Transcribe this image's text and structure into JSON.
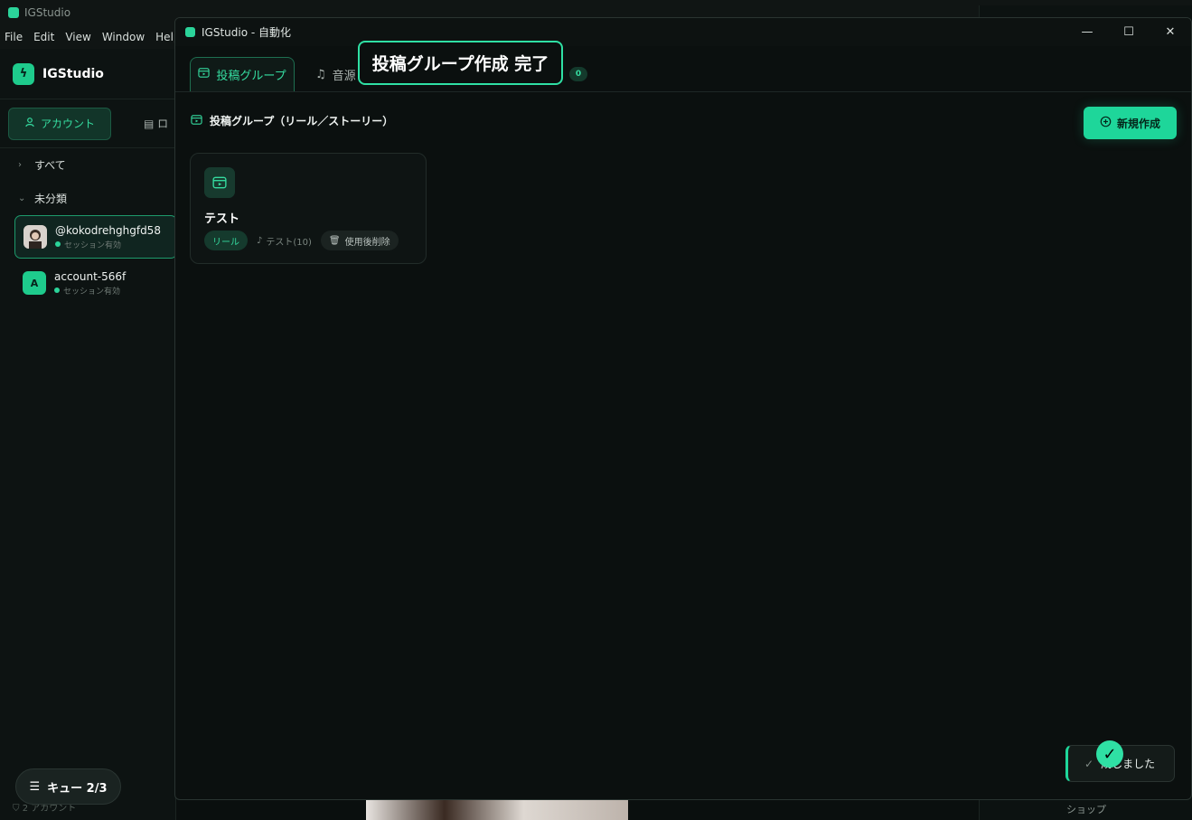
{
  "app": {
    "title": "IGStudio",
    "menu": [
      "File",
      "Edit",
      "View",
      "Window",
      "Help"
    ],
    "brand": "IGStudio",
    "side_tabs": {
      "active": "アカウント",
      "other": "ロ"
    },
    "groups": {
      "all": "すべて",
      "uncategorized": "未分類"
    },
    "accounts": [
      {
        "name": "@kokodrehghgfd58",
        "status": "セッション有効",
        "active": true
      },
      {
        "name": "account-566f",
        "status": "セッション有効",
        "initial": "A",
        "active": false
      }
    ],
    "queue_label": "キュー 2/3",
    "footer": "2 アカウント",
    "right_panel": {
      "shop": "ショップ"
    }
  },
  "window": {
    "title": "IGStudio - 自動化",
    "tabs": [
      {
        "label": "投稿グループ",
        "active": true
      },
      {
        "label": "音源",
        "active": false
      }
    ],
    "tab_badge": "0",
    "section_title": "投稿グループ（リール／ストーリー）",
    "new_button": "新規作成",
    "card": {
      "title": "テスト",
      "tag_type": "リール",
      "tag_music": "テスト(10)",
      "tag_delete": "使用後削除"
    },
    "toast": "成しました"
  },
  "overlay": {
    "banner": "投稿グループ作成 完了"
  },
  "colors": {
    "accent": "#1ed69a",
    "background": "#0b100f"
  }
}
